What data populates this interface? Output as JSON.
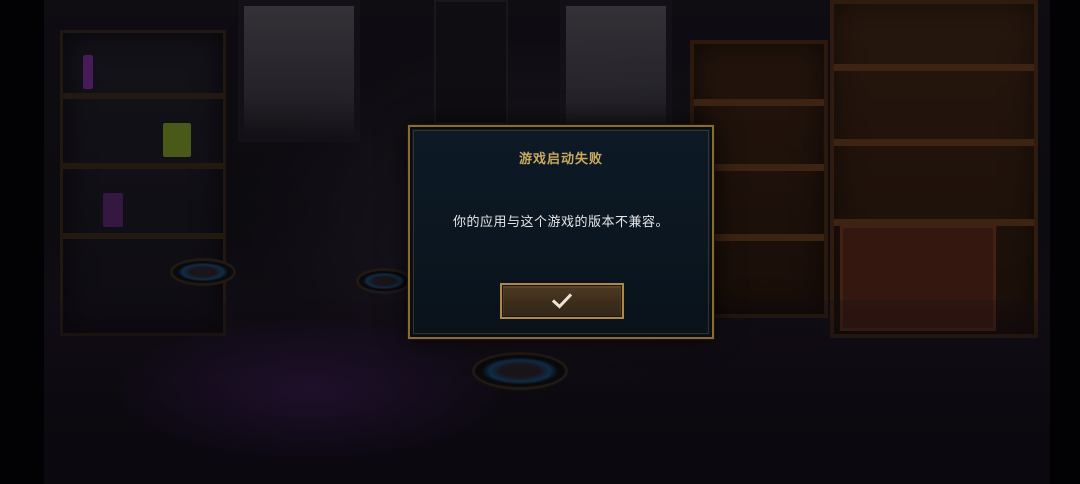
{
  "dialog": {
    "title": "游戏启动失败",
    "message": "你的应用与这个游戏的版本不兼容。",
    "confirm_icon": "checkmark-icon"
  },
  "colors": {
    "title_gold": "#c9a95e",
    "border_gold": "#8a6b36",
    "panel_bg": "#0d1a26",
    "button_bg": "#3c2d1a",
    "message_text": "#e6e6e6"
  }
}
